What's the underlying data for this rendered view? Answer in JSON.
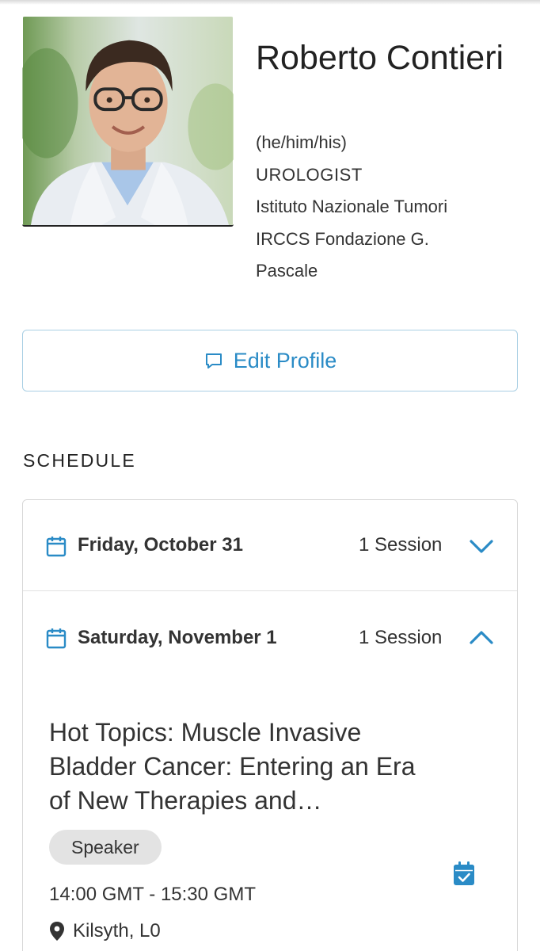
{
  "profile": {
    "name": "Roberto Contieri",
    "pronouns": "(he/him/his)",
    "role": "UROLOGIST",
    "institution": "Istituto Nazionale Tumori IRCCS Fondazione G. Pascale"
  },
  "actions": {
    "edit_profile_label": "Edit Profile"
  },
  "schedule": {
    "title": "SCHEDULE",
    "days": [
      {
        "label": "Friday, October 31",
        "count": "1 Session",
        "expanded": false
      },
      {
        "label": "Saturday, November 1",
        "count": "1 Session",
        "expanded": true
      }
    ],
    "session": {
      "title": "Hot Topics: Muscle Invasive Bladder Cancer: Entering an Era of New Therapies and…",
      "role_badge": "Speaker",
      "time": "14:00 GMT - 15:30 GMT",
      "location": "Kilsyth, L0"
    }
  },
  "colors": {
    "accent": "#2a8bc6",
    "border": "#d8d8d8",
    "badge_bg": "#e3e3e3",
    "text": "#333333"
  },
  "icons": {
    "edit": "comment-icon",
    "day": "calendar-icon",
    "collapsed": "chevron-down-icon",
    "expanded": "chevron-up-icon",
    "add_to_calendar": "calendar-check-icon",
    "location": "map-pin-icon"
  }
}
